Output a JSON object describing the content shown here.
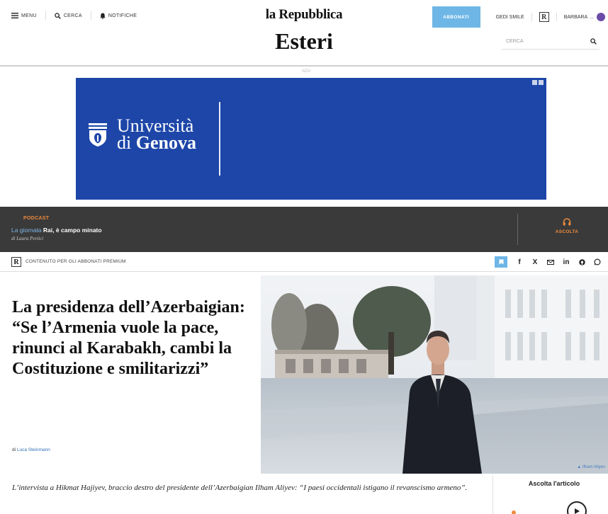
{
  "header": {
    "menu_label": "MENU",
    "search_label": "CERCA",
    "notifications_label": "NOTIFICHE",
    "brand": "la Repubblica",
    "section": "Esteri",
    "subscribe_label": "ABBONATI",
    "gedi_label": "GEDI SMILE",
    "r_badge": "R",
    "user_label": "BARBARA",
    "user_suffix": "...",
    "search_placeholder": "CERCA"
  },
  "ad": {
    "label": "ADV",
    "line1": "Università",
    "line2_prefix": "di ",
    "line2_bold": "Genova",
    "colors": {
      "background": "#1d46a8",
      "text": "#ffffff"
    }
  },
  "podcast": {
    "label": "PODCAST",
    "show": "La giornata",
    "episode": "Rai, è campo minato",
    "author": "di Laura Pertici",
    "listen_label": "ASCOLTA",
    "icon": "headphones-icon"
  },
  "premium_bar": {
    "badge": "R",
    "text": "CONTENUTO PER GLI ABBONATI PREMIUM",
    "share_icons": [
      "bookmark-icon",
      "facebook-icon",
      "x-icon",
      "email-icon",
      "linkedin-icon",
      "pinterest-icon",
      "whatsapp-icon"
    ],
    "share_labels": {
      "facebook": "f",
      "x": "X",
      "linkedin": "in"
    }
  },
  "article": {
    "headline": "La presidenza dell’Azerbaigian: “Se l’Armenia vuole la pace, rinunci al Karabakh, cambi la Costituzione e smilitarizzi”",
    "byline_prefix": "di ",
    "author": "Luca Steinmann",
    "photo_credit": "▲ Ilham Aliyev",
    "lead": "L’intervista a Hikmat Hajiyev, braccio destro del presidente dell’Azerbaigian Ilham Aliyev: “I paesi occidentali istigano il revanscismo armeno”."
  },
  "sidebar": {
    "listen_title": "Ascolta l'articolo"
  },
  "colors": {
    "accent_blue": "#6eb6e6",
    "podcast_orange": "#ef8a3d",
    "podcast_bg": "#3a3a3a",
    "link_blue": "#2f6fb5"
  }
}
